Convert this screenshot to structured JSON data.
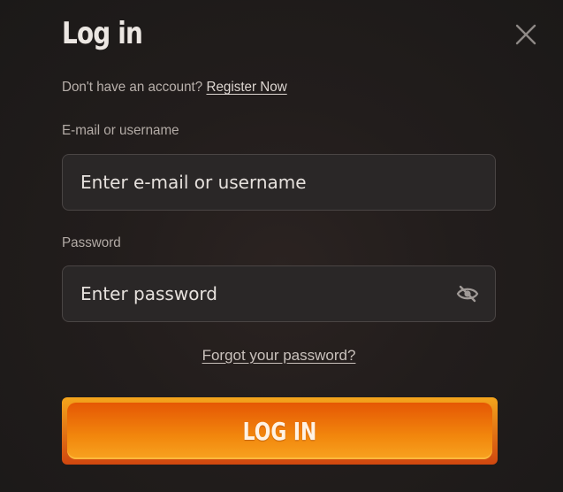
{
  "modal": {
    "title": "Log in",
    "close_icon": "close-icon"
  },
  "register": {
    "prompt": "Don't have an account?",
    "link": "Register Now"
  },
  "email_field": {
    "label": "E-mail or username",
    "placeholder": "Enter e-mail or username",
    "value": ""
  },
  "password_field": {
    "label": "Password",
    "placeholder": "Enter password",
    "value": "",
    "toggle_icon": "eye-slash-icon"
  },
  "forgot_password": "Forgot your password?",
  "login_button": {
    "label": "LOG IN"
  },
  "colors": {
    "background": "#1f1c1b",
    "input_bg": "#2a2727",
    "input_border": "#4a4544",
    "button_top": "#f4a51c",
    "button_bottom": "#d0470f",
    "text": "#ece7e3",
    "muted_text": "#b3aba6"
  }
}
